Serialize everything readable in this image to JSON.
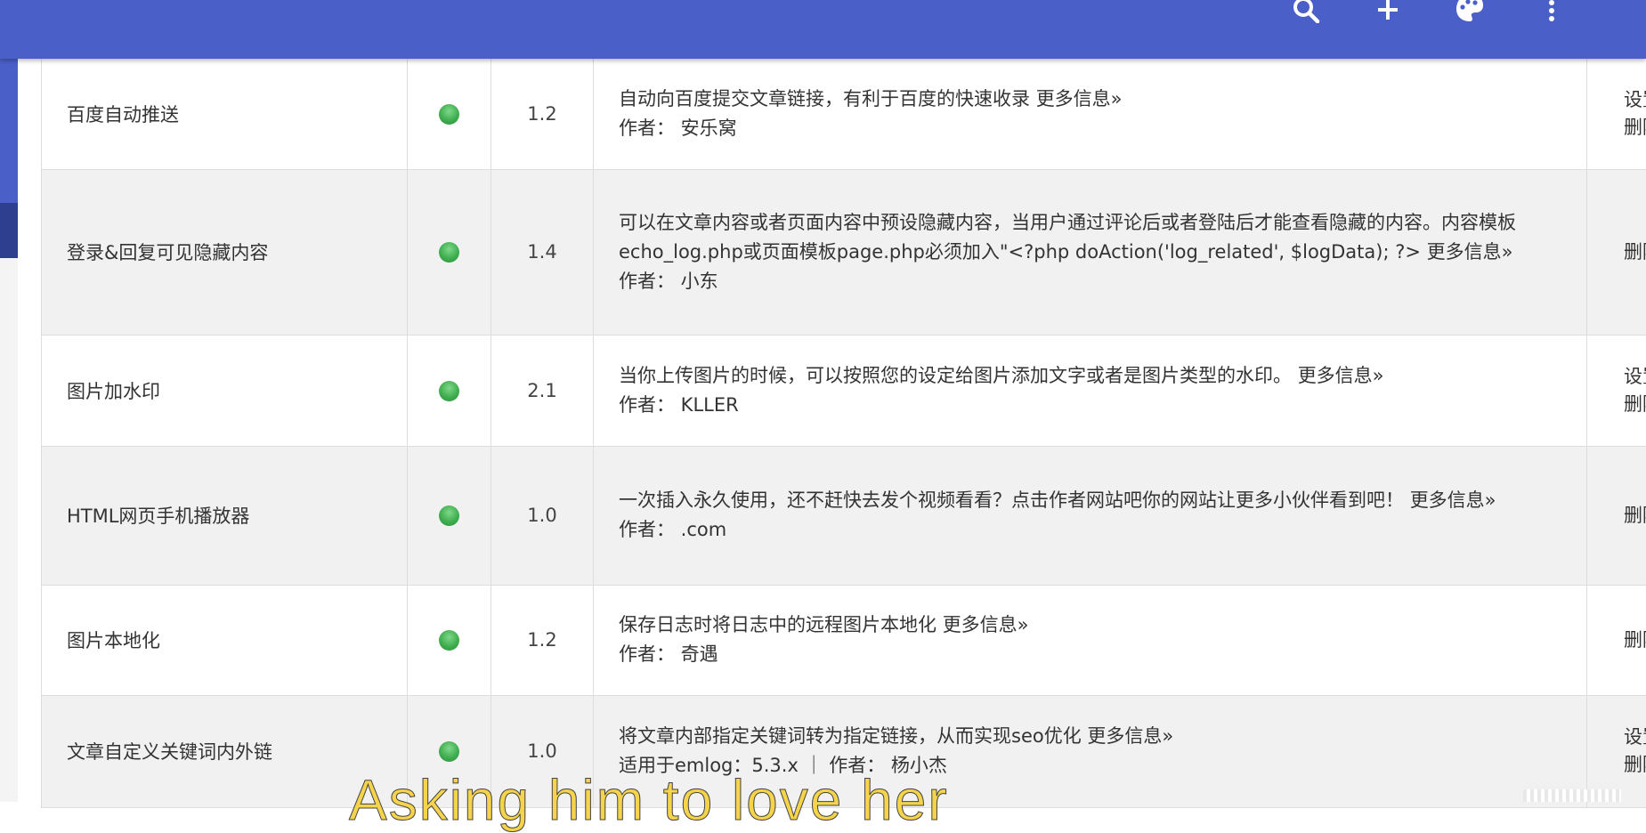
{
  "topbar": {
    "color": "#4a5fc8",
    "actions": [
      {
        "icon": "search-icon"
      },
      {
        "icon": "plus-icon"
      },
      {
        "icon": "palette-icon"
      },
      {
        "icon": "more-vert-icon"
      }
    ]
  },
  "status_color": "#3fae4f",
  "plugins": [
    {
      "name": "百度自动推送",
      "status": "enabled",
      "version": "1.2",
      "description": "自动向百度提交文章链接，有利于百度的快速收录",
      "more": "更多信息»",
      "author_line": "作者： 安乐窝",
      "ops": [
        "设置",
        "删除"
      ]
    },
    {
      "name": "登录&回复可见隐藏内容",
      "status": "enabled",
      "version": "1.4",
      "description": "可以在文章内容或者页面内容中预设隐藏内容，当用户通过评论后或者登陆后才能查看隐藏的内容。内容模板echo_log.php或页面模板page.php必须加入\"<?php doAction('log_related', $logData); ?>",
      "more": "更多信息»",
      "author_line": "作者： 小东",
      "ops": [
        "删除"
      ]
    },
    {
      "name": "图片加水印",
      "status": "enabled",
      "version": "2.1",
      "description": "当你上传图片的时候，可以按照您的设定给图片添加文字或者是图片类型的水印。",
      "more": "更多信息»",
      "author_line": "作者： KLLER",
      "ops": [
        "设置",
        "删除"
      ]
    },
    {
      "name": "HTML网页手机播放器",
      "status": "enabled",
      "version": "1.0",
      "description": "一次插入永久使用，还不赶快去发个视频看看？点击作者网站吧你的网站让更多小伙伴看到吧！",
      "more": "更多信息»",
      "author_line": "作者： .com",
      "ops": [
        "删除"
      ]
    },
    {
      "name": "图片本地化",
      "status": "enabled",
      "version": "1.2",
      "description": "保存日志时将日志中的远程图片本地化",
      "more": "更多信息»",
      "author_line": "作者： 奇遇",
      "ops": [
        "删除"
      ]
    },
    {
      "name": "文章自定义关键词内外链",
      "status": "enabled",
      "version": "1.0",
      "description": "将文章内部指定关键词转为指定链接，从而实现seo优化",
      "more": "更多信息»",
      "author_line": "适用于emlog：5.3.x ｜ 作者： 杨小杰",
      "ops": [
        "设置",
        "删除"
      ]
    }
  ],
  "watermark": "Asking him to love her"
}
